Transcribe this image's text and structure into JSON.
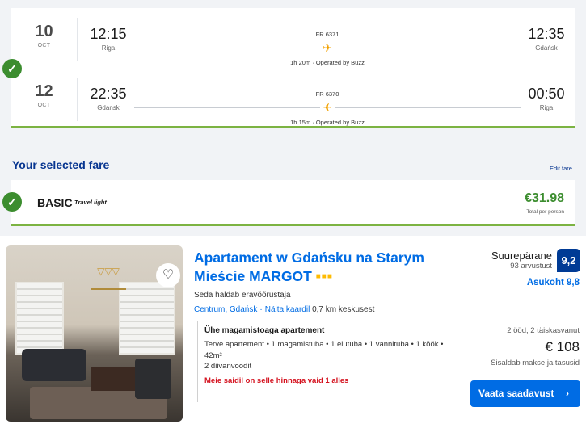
{
  "flights": [
    {
      "day": "10",
      "month": "OCT",
      "dep_time": "12:15",
      "dep_city": "Riga",
      "flight_no": "FR 6371",
      "duration": "1h 20m · Operated by Buzz",
      "arr_time": "12:35",
      "arr_city": "Gdańsk"
    },
    {
      "day": "12",
      "month": "OCT",
      "dep_time": "22:35",
      "dep_city": "Gdansk",
      "flight_no": "FR 6370",
      "duration": "1h 15m · Operated by Buzz",
      "arr_time": "00:50",
      "arr_city": "Riga"
    }
  ],
  "fare": {
    "section_title": "Your selected fare",
    "edit_label": "Edit fare",
    "name": "BASIC",
    "subtitle": "Travel light",
    "price": "€31.98",
    "price_note": "Total per person"
  },
  "hotel": {
    "name": "Apartament w Gdańsku na Starym Mieście MARGOT",
    "stars_glyph": "■■■",
    "managed_by": "Seda haldab eravõõrustaja",
    "location_link": "Centrum, Gdańsk",
    "map_link": "Näita kaardil",
    "distance": "0,7 km keskusest",
    "room_type": "Ühe magamistoaga apartement",
    "room_desc": "Terve apartement • 1 magamistuba • 1 elutuba • 1 vannituba • 1 köök • 42m²",
    "beds": "2 diivanvoodit",
    "scarcity": "Meie saidil on selle hinnaga vaid 1 alles",
    "score_word": "Suurepärane",
    "reviews": "93 arvustust",
    "score": "9,2",
    "location_score": "Asukoht 9,8",
    "guests": "2 ööd, 2 täiskasvanut",
    "price": "€ 108",
    "taxes": "Sisaldab makse ja tasusid",
    "cta_label": "Vaata saadavust",
    "cta_icon": "chevron-right-icon",
    "favorite_icon": "heart-icon"
  },
  "colors": {
    "accent": "#006ce4",
    "brand_dark": "#003b95",
    "fare_green": "#3c8d2f",
    "flight_blue": "#073590",
    "plane": "#f2a100"
  }
}
